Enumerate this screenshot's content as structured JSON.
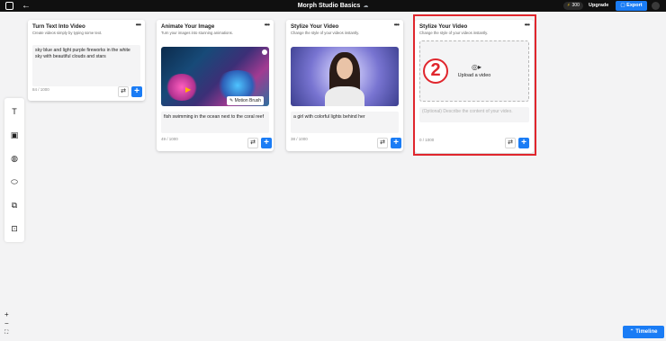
{
  "header": {
    "back_glyph": "←",
    "project_title": "Morph Studio Basics",
    "cloud_glyph": "☁",
    "credits": "300",
    "bolt_glyph": "⚡",
    "upgrade_label": "Upgrade",
    "export_label": "Export"
  },
  "toolbar": {
    "icons": [
      "text-to-video-icon",
      "image-to-video-icon",
      "video-to-video-icon",
      "mask-icon",
      "copy-icon",
      "video-upscale-icon"
    ],
    "glyphs": [
      "T",
      "▣",
      "◍",
      "⬭",
      "⧉",
      "⊡"
    ]
  },
  "cards": [
    {
      "title": "Turn Text Into Video",
      "subtitle": "Create videos simply by typing some text.",
      "prompt": "sky blue and light purple fireworks in the white sky with beautiful clouds and stars",
      "counter": "84 / 1000"
    },
    {
      "title": "Animate Your Image",
      "subtitle": "Turn your images into stunning animations.",
      "motion_brush_label": "Motion Brush",
      "prompt": "fish swimming in the ocean next to the coral reef",
      "counter": "49 / 1000"
    },
    {
      "title": "Stylize Your Video",
      "subtitle": "Change the style of your videos instantly.",
      "prompt": "a girl with colorful lights behind her",
      "counter": "38 / 1000"
    },
    {
      "title": "Stylize Your Video",
      "subtitle": "Change the style of your videos instantly.",
      "upload_label": "Upload a video",
      "description_placeholder": "(Optional) Describe the content of your video.",
      "counter": "0 / 1000"
    }
  ],
  "more_glyph": "•••",
  "swap_glyph": "⇄",
  "add_glyph": "+",
  "annotation": {
    "step_number": "2",
    "color": "#e0262d"
  },
  "zoom": {
    "in": "+",
    "out": "−",
    "fit": "⛶"
  },
  "timeline_label": "Timeline",
  "colors": {
    "accent": "#1a7cf5",
    "topbar": "#101010",
    "canvas": "#f3f3f4"
  }
}
